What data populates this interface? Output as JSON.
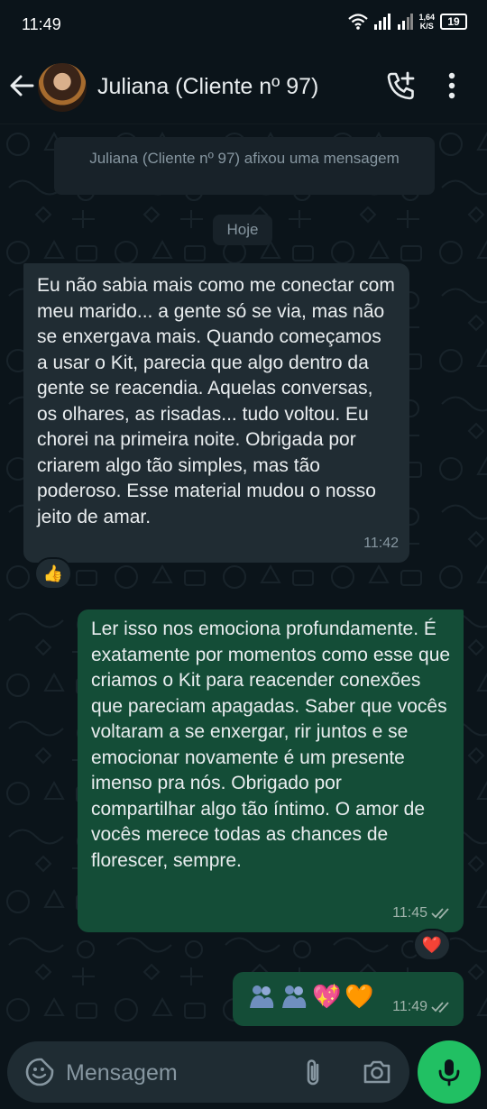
{
  "status_bar": {
    "time": "11:49",
    "speed_value": "1,64",
    "speed_unit": "K/S",
    "battery": "19"
  },
  "header": {
    "contact_name": "Juliana (Cliente nº 97)"
  },
  "chat": {
    "system_message": "Juliana (Cliente nº 97) afixou uma mensagem",
    "date_chip": "Hoje",
    "messages": [
      {
        "direction": "incoming",
        "text": "Eu não sabia mais como me conectar com meu marido... a gente só se via, mas não se enxergava mais. Quando começamos a usar o Kit, parecia que algo dentro da gente se reacendia. Aquelas conversas, os olhares, as risadas... tudo voltou. Eu chorei na primeira noite. Obrigada por criarem algo tão simples, mas tão poderoso. Esse material mudou o nosso jeito de amar.",
        "time": "11:42",
        "reaction": "👍"
      },
      {
        "direction": "outgoing",
        "text": "Ler isso nos emociona profundamente. É exatamente por momentos como esse que criamos o Kit  para reacender conexões que pareciam apagadas. Saber que vocês voltaram a se enxergar, rir juntos e se emocionar novamente é um presente imenso pra nós. Obrigado por compartilhar algo tão íntimo. O amor de vocês merece todas as chances de florescer, sempre.",
        "time": "11:45",
        "reaction": "❤️"
      },
      {
        "direction": "outgoing",
        "emojis": [
          "people-hugging",
          "people-hugging",
          "💖",
          "🧡"
        ],
        "time": "11:49"
      }
    ]
  },
  "composer": {
    "placeholder": "Mensagem"
  },
  "colors": {
    "background": "#0b141a",
    "incoming_bubble": "#202c33",
    "outgoing_bubble": "#144d37",
    "accent_green": "#21c063",
    "meta_text": "#8696a0"
  }
}
